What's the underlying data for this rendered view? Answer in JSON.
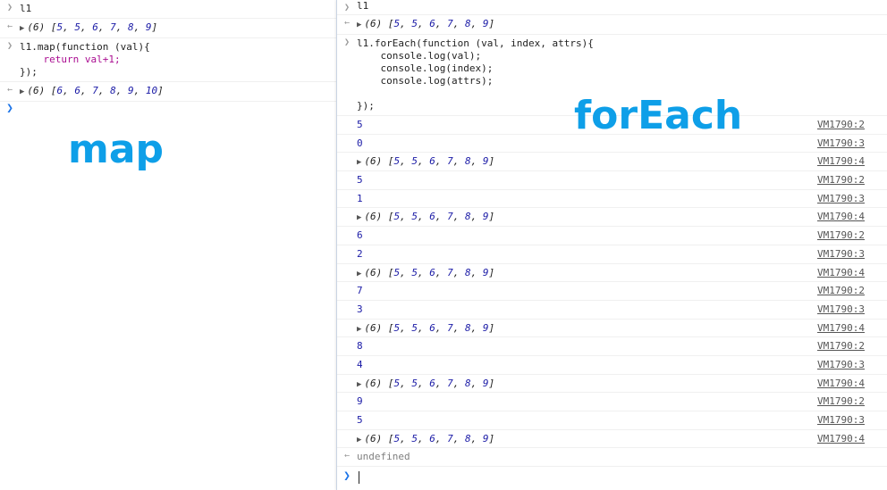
{
  "left": {
    "entries": [
      {
        "kind": "input",
        "text": "l1"
      },
      {
        "kind": "array",
        "count": "(6)",
        "items": [
          "5",
          "5",
          "6",
          "7",
          "8",
          "9"
        ]
      },
      {
        "kind": "code",
        "lines": [
          "l1.map(function (val){",
          "    return val+1;",
          "});"
        ]
      },
      {
        "kind": "array",
        "count": "(6)",
        "items": [
          "6",
          "6",
          "7",
          "8",
          "9",
          "10"
        ]
      }
    ],
    "label": "map"
  },
  "right": {
    "input_text": "l1",
    "array": {
      "count": "(6)",
      "items": [
        "5",
        "5",
        "6",
        "7",
        "8",
        "9"
      ]
    },
    "code_lines": [
      "l1.forEach(function (val, index, attrs){",
      "    console.log(val);",
      "    console.log(index);",
      "    console.log(attrs);",
      "",
      "});"
    ],
    "label": "forEach",
    "logs": [
      {
        "type": "num",
        "value": "5",
        "src": "VM1790:2"
      },
      {
        "type": "num",
        "value": "0",
        "src": "VM1790:3"
      },
      {
        "type": "arr",
        "src": "VM1790:4"
      },
      {
        "type": "num",
        "value": "5",
        "src": "VM1790:2"
      },
      {
        "type": "num",
        "value": "1",
        "src": "VM1790:3"
      },
      {
        "type": "arr",
        "src": "VM1790:4"
      },
      {
        "type": "num",
        "value": "6",
        "src": "VM1790:2"
      },
      {
        "type": "num",
        "value": "2",
        "src": "VM1790:3"
      },
      {
        "type": "arr",
        "src": "VM1790:4"
      },
      {
        "type": "num",
        "value": "7",
        "src": "VM1790:2"
      },
      {
        "type": "num",
        "value": "3",
        "src": "VM1790:3"
      },
      {
        "type": "arr",
        "src": "VM1790:4"
      },
      {
        "type": "num",
        "value": "8",
        "src": "VM1790:2"
      },
      {
        "type": "num",
        "value": "4",
        "src": "VM1790:3"
      },
      {
        "type": "arr",
        "src": "VM1790:4"
      },
      {
        "type": "num",
        "value": "9",
        "src": "VM1790:2"
      },
      {
        "type": "num",
        "value": "5",
        "src": "VM1790:3"
      },
      {
        "type": "arr",
        "src": "VM1790:4"
      }
    ],
    "result": "undefined"
  },
  "icons": {
    "input": "chevron-right-icon",
    "output": "return-arrow-icon",
    "expand": "triangle-right-icon",
    "prompt": "prompt-chevron-icon"
  },
  "colors": {
    "label": "#0e9fe8",
    "number": "#1a1aa6",
    "keyword": "#aa0d91",
    "prompt": "#1a73e8"
  }
}
